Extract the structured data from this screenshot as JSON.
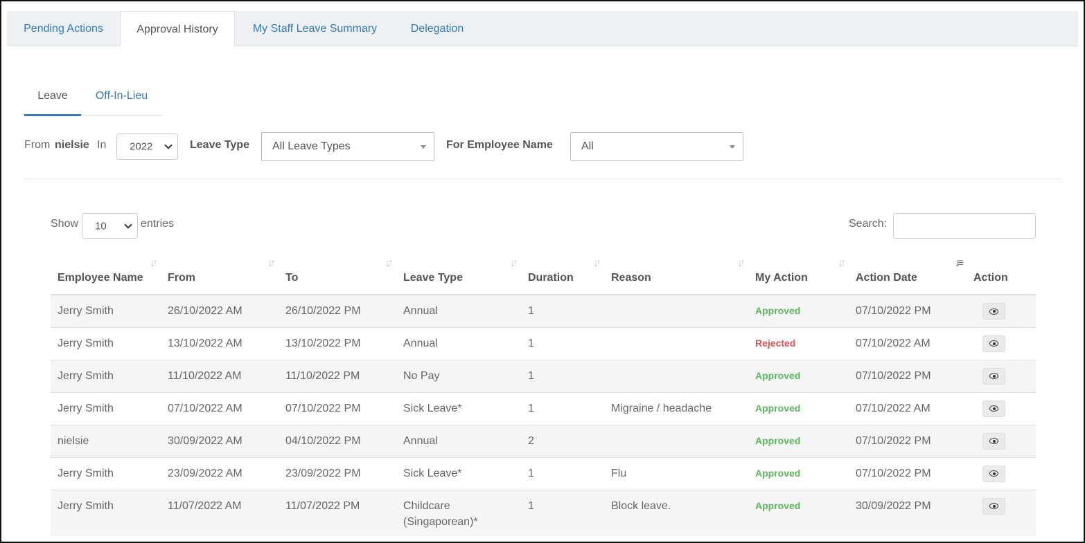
{
  "tabs": [
    {
      "label": "Pending Actions"
    },
    {
      "label": "Approval History"
    },
    {
      "label": "My Staff Leave Summary"
    },
    {
      "label": "Delegation"
    }
  ],
  "sub_tabs": [
    {
      "label": "Leave"
    },
    {
      "label": "Off-In-Lieu"
    }
  ],
  "filters": {
    "from_label": "From",
    "from_user": "nielsie",
    "in_label": "In",
    "year": "2022",
    "leave_type_label": "Leave Type",
    "leave_type_value": "All Leave Types",
    "employee_label": "For Employee Name",
    "employee_value": "All"
  },
  "datatable": {
    "show_label": "Show",
    "page_size": "10",
    "entries_label": "entries",
    "search_label": "Search:",
    "search_value": ""
  },
  "table": {
    "headers": [
      "Employee Name",
      "From",
      "To",
      "Leave Type",
      "Duration",
      "Reason",
      "My Action",
      "Action Date",
      "Action"
    ],
    "rows": [
      {
        "employee": "Jerry Smith",
        "from": "26/10/2022 AM",
        "to": "26/10/2022 PM",
        "leave_type": "Annual",
        "duration": "1",
        "reason": "",
        "my_action": "Approved",
        "action_date": "07/10/2022 PM"
      },
      {
        "employee": "Jerry Smith",
        "from": "13/10/2022 AM",
        "to": "13/10/2022 PM",
        "leave_type": "Annual",
        "duration": "1",
        "reason": "",
        "my_action": "Rejected",
        "action_date": "07/10/2022 AM"
      },
      {
        "employee": "Jerry Smith",
        "from": "11/10/2022 AM",
        "to": "11/10/2022 PM",
        "leave_type": "No Pay",
        "duration": "1",
        "reason": "",
        "my_action": "Approved",
        "action_date": "07/10/2022 PM"
      },
      {
        "employee": "Jerry Smith",
        "from": "07/10/2022 AM",
        "to": "07/10/2022 PM",
        "leave_type": "Sick Leave*",
        "duration": "1",
        "reason": "Migraine / headache",
        "my_action": "Approved",
        "action_date": "07/10/2022 AM"
      },
      {
        "employee": "nielsie",
        "from": "30/09/2022 AM",
        "to": "04/10/2022 PM",
        "leave_type": "Annual",
        "duration": "2",
        "reason": "",
        "my_action": "Approved",
        "action_date": "07/10/2022 PM"
      },
      {
        "employee": "Jerry Smith",
        "from": "23/09/2022 AM",
        "to": "23/09/2022 PM",
        "leave_type": "Sick Leave*",
        "duration": "1",
        "reason": "Flu",
        "my_action": "Approved",
        "action_date": "07/10/2022 PM"
      },
      {
        "employee": "Jerry Smith",
        "from": "11/07/2022 AM",
        "to": "11/07/2022 PM",
        "leave_type": "Childcare (Singaporean)*",
        "duration": "1",
        "reason": "Block leave.",
        "my_action": "Approved",
        "action_date": "30/09/2022 PM"
      }
    ]
  },
  "colors": {
    "link": "#337ab7",
    "approved": "#5cb85c",
    "rejected": "#d9534f"
  },
  "icons": {
    "sort": "sort-icon",
    "sort_active": "sort-desc-icon",
    "view": "eye-icon"
  }
}
